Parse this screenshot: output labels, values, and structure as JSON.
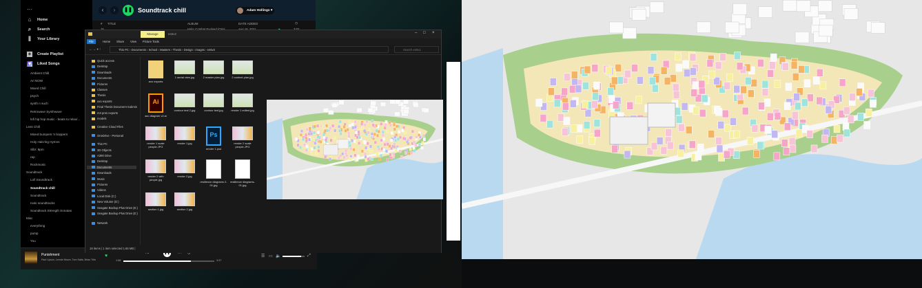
{
  "spotify": {
    "title": "Soundtrack chill",
    "user": "Adam Hollings",
    "nav": [
      {
        "label": "Home",
        "icon": "home-icon"
      },
      {
        "label": "Search",
        "icon": "search-icon"
      },
      {
        "label": "Your Library",
        "icon": "library-icon"
      }
    ],
    "create_playlist": "Create Playlist",
    "liked_songs": "Liked Songs",
    "playlists": [
      {
        "label": "Ambient Chill",
        "type": "item"
      },
      {
        "label": "Ari NOW",
        "type": "item"
      },
      {
        "label": "Mixed Chill",
        "type": "item"
      },
      {
        "label": "psych",
        "type": "item"
      },
      {
        "label": "synth n such",
        "type": "item"
      },
      {
        "label": "Retrowave Synthwave",
        "type": "item"
      },
      {
        "label": "lofi hip hop music - beats to relax/...",
        "type": "item"
      },
      {
        "label": "Less Chill",
        "type": "folder"
      },
      {
        "label": "Mixed bumpers 'n boppers",
        "type": "item"
      },
      {
        "label": "Holy Halo'ing Hymns",
        "type": "item"
      },
      {
        "label": "Slbr: 8pm",
        "type": "item"
      },
      {
        "label": "rap",
        "type": "item"
      },
      {
        "label": "Rockmusic",
        "type": "item"
      },
      {
        "label": "Soundtrack",
        "type": "folder"
      },
      {
        "label": "Lofi Soundtrack",
        "type": "item"
      },
      {
        "label": "Soundtrack chill",
        "type": "active"
      },
      {
        "label": "Soundtrack",
        "type": "item"
      },
      {
        "label": "Halo soundtracks",
        "type": "item"
      },
      {
        "label": "Soundtrack Strength Sonatas",
        "type": "item"
      },
      {
        "label": "Misc",
        "type": "folder"
      },
      {
        "label": "everything",
        "type": "item"
      },
      {
        "label": "pump",
        "type": "item"
      },
      {
        "label": "You",
        "type": "item"
      }
    ],
    "columns": {
      "num": "#",
      "title": "TITLE",
      "album": "ALBUM",
      "date": "DATE ADDED"
    },
    "row": {
      "num": "15",
      "album": "Halo: Combat Evolved (Origi...",
      "date": "Aug 16, 2021",
      "duration": "3:02"
    },
    "player": {
      "track": "Punishment",
      "artists": "Paul Lipson, Lennie Moore, Tom Salta, Brian Trifo",
      "elapsed": "1:58",
      "total": "3:37",
      "progress": 0.74,
      "volume": 0.85
    }
  },
  "explorer": {
    "title": "..",
    "manage_tab": "Manage",
    "folder_name": "es5v2",
    "ribbon_tabs": [
      "File",
      "Home",
      "Share",
      "View",
      "Picture Tools"
    ],
    "breadcrumb": [
      "This PC",
      "Documents",
      "School",
      "Masters",
      "Thesis",
      "Design",
      "images",
      "es5v2"
    ],
    "search_placeholder": "Search es5v2",
    "nav": [
      {
        "label": "Quick access",
        "icon": "star"
      },
      {
        "label": "Desktop",
        "icon": "b"
      },
      {
        "label": "Downloads",
        "icon": "b"
      },
      {
        "label": "Documents",
        "icon": "b"
      },
      {
        "label": "Pictures",
        "icon": "b"
      },
      {
        "label": "Classes",
        "icon": "f"
      },
      {
        "label": "Thesis",
        "icon": "f"
      },
      {
        "label": "axo exports",
        "icon": "f"
      },
      {
        "label": "Final Thesis Document Submis",
        "icon": "f"
      },
      {
        "label": "m3 pres exports",
        "icon": "f"
      },
      {
        "label": "models",
        "icon": "f"
      },
      {
        "label": "Creative Cloud Files",
        "icon": "f"
      },
      {
        "label": "OneDrive - Personal",
        "icon": "b"
      },
      {
        "label": "This PC",
        "icon": "b"
      },
      {
        "label": "3D Objects",
        "icon": "b"
      },
      {
        "label": "A390 Drive",
        "icon": "b"
      },
      {
        "label": "Desktop",
        "icon": "b"
      },
      {
        "label": "Documents",
        "icon": "b",
        "selected": true
      },
      {
        "label": "Downloads",
        "icon": "b"
      },
      {
        "label": "Music",
        "icon": "b"
      },
      {
        "label": "Pictures",
        "icon": "b"
      },
      {
        "label": "Videos",
        "icon": "b"
      },
      {
        "label": "Local Disk (C:)",
        "icon": "b"
      },
      {
        "label": "New Volume (D:)",
        "icon": "b"
      },
      {
        "label": "Seagate Backup Plus Drive (E:)",
        "icon": "b"
      },
      {
        "label": "Seagate Backup Plus Drive (E:)",
        "icon": "b"
      },
      {
        "label": "Network",
        "icon": "b"
      }
    ],
    "files": [
      {
        "name": "axo exports",
        "kind": "folder"
      },
      {
        "name": "1 aerial view.jpg",
        "kind": "img"
      },
      {
        "name": "2 master plan.jpg",
        "kind": "img"
      },
      {
        "name": "2 context plan.jpg",
        "kind": "img"
      },
      {
        "name": "axo diagram v2.ai",
        "kind": "ai"
      },
      {
        "name": "contour test 2.jpg",
        "kind": "img"
      },
      {
        "name": "contour test.jpg",
        "kind": "img"
      },
      {
        "name": "render 1 edited.jpg",
        "kind": "img"
      },
      {
        "name": "render 1 scale people.JPG",
        "kind": "img"
      },
      {
        "name": "render 1.jpg",
        "kind": "img"
      },
      {
        "name": "render 1.psd",
        "kind": "psd"
      },
      {
        "name": "render 2 scale people.JPG",
        "kind": "img"
      },
      {
        "name": "render 2 with people.jpg",
        "kind": "img"
      },
      {
        "name": "render 2.jpg",
        "kind": "img"
      },
      {
        "name": "resilience diagrams 2-01.jpg",
        "kind": "doc"
      },
      {
        "name": "resilience diagrams-01.jpg",
        "kind": "doc"
      },
      {
        "name": "section 1.jpg",
        "kind": "img"
      },
      {
        "name": "section 2.jpg",
        "kind": "img"
      }
    ],
    "status": "18 items  |  1 item selected  1.65 MB  |"
  },
  "colors": {
    "spotify_green": "#1ed760",
    "file_tab": "#1a73c8",
    "manage": "#f5f08a"
  }
}
